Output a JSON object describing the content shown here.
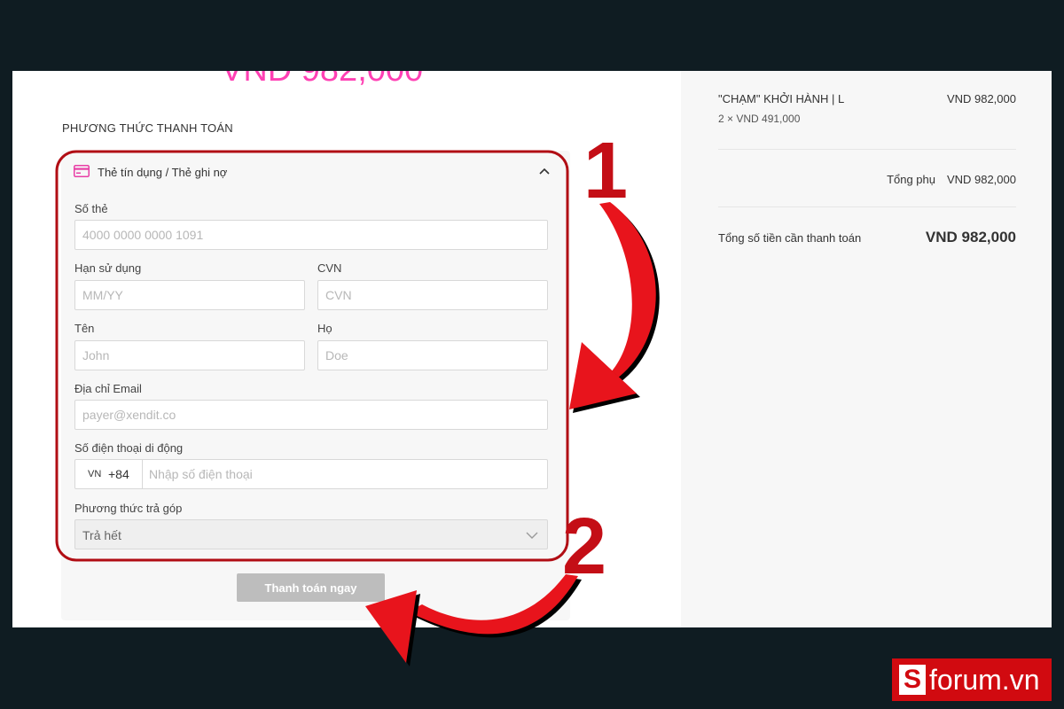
{
  "header": {
    "amount_partial": "VND 982,000"
  },
  "payment": {
    "section_title": "PHƯƠNG THỨC THANH TOÁN",
    "method_label": "Thẻ tín dụng / Thẻ ghi nợ",
    "card_number": {
      "label": "Số thẻ",
      "placeholder": "4000 0000 0000 1091"
    },
    "expiry": {
      "label": "Hạn sử dụng",
      "placeholder": "MM/YY"
    },
    "cvn": {
      "label": "CVN",
      "placeholder": "CVN"
    },
    "first_name": {
      "label": "Tên",
      "placeholder": "John"
    },
    "last_name": {
      "label": "Họ",
      "placeholder": "Doe"
    },
    "email": {
      "label": "Địa chỉ Email",
      "placeholder": "payer@xendit.co"
    },
    "phone": {
      "label": "Số điện thoại di động",
      "country_flag": "VN",
      "country_code": "+84",
      "placeholder": "Nhập số điện thoại"
    },
    "installment": {
      "label": "Phương thức trả góp",
      "selected": "Trả hết"
    },
    "pay_button": "Thanh toán ngay"
  },
  "summary": {
    "item_name": "\"CHẠM\" KHỞI HÀNH | L",
    "item_qty": "2 × VND 491,000",
    "item_price": "VND 982,000",
    "subtotal_label": "Tổng phụ",
    "subtotal_value": "VND 982,000",
    "total_label": "Tổng số tiền cần thanh toán",
    "total_value": "VND 982,000"
  },
  "annotations": {
    "step1": "1",
    "step2": "2",
    "colors": {
      "accent": "#c40e16",
      "brand_pink": "#ff40b4"
    }
  },
  "watermark": {
    "s": "S",
    "text": "forum.vn"
  }
}
